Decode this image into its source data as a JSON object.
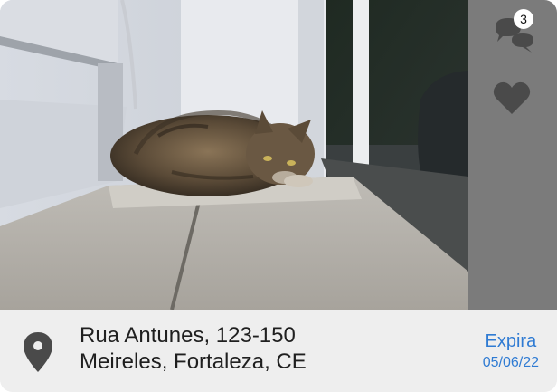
{
  "photo": {
    "alt": "Cat lying on a wooden bench"
  },
  "sidebar": {
    "chat_count": "3"
  },
  "footer": {
    "address_line1": "Rua Antunes, 123-150",
    "address_line2": "Meireles, Fortaleza, CE",
    "expiry_label": "Expira",
    "expiry_date": "05/06/22"
  },
  "colors": {
    "accent": "#2f7bd3",
    "sidebar": "#7b7b7b",
    "footer": "#eeeeee",
    "icon": "#4a4a4a"
  },
  "icons": [
    "chat-icon",
    "heart-icon",
    "location-pin-icon"
  ]
}
